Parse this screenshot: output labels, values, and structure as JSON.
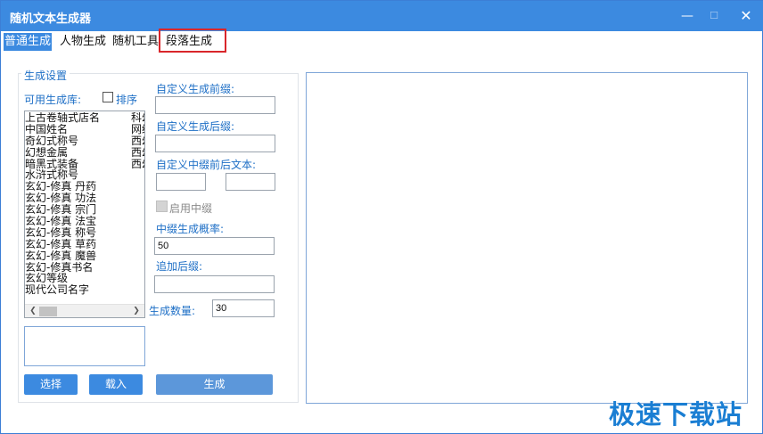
{
  "window": {
    "title": "随机文本生成器",
    "minimize_glyph": "—",
    "maximize_glyph": "☐",
    "close_glyph": "✕"
  },
  "tabs": [
    {
      "label": "普通生成",
      "active": true
    },
    {
      "label": "人物生成",
      "active": false
    },
    {
      "label": "随机工具",
      "active": false
    },
    {
      "label": "段落生成",
      "active": false
    }
  ],
  "settings": {
    "group_title": "生成设置",
    "library_label": "可用生成库:",
    "sort_label": "排序",
    "sort_checked": false,
    "library_items": [
      "上古卷轴式店名",
      "中国姓名",
      "奇幻式称号",
      "幻想金属",
      "暗黑式装备",
      "水浒式称号",
      "玄幻-修真 丹药",
      "玄幻-修真 功法",
      "玄幻-修真 宗门",
      "玄幻-修真 法宝",
      "玄幻-修真 称号",
      "玄幻-修真 草药",
      "玄幻-修真 魔兽",
      "玄幻-修真书名",
      "玄幻等级",
      "现代公司名字"
    ],
    "library_items_col2": [
      "科幻",
      "网络",
      "西幻",
      "西幻",
      "西幻"
    ],
    "prefix_label": "自定义生成前缀:",
    "prefix_value": "",
    "suffix_label": "自定义生成后缀:",
    "suffix_value": "",
    "middle_label": "自定义中缀前后文本:",
    "middle_before_value": "",
    "middle_after_value": "",
    "enable_middle_label": "启用中缀",
    "middle_prob_label": "中缀生成概率:",
    "middle_prob_value": "50",
    "append_suffix_label": "追加后缀:",
    "append_suffix_value": "",
    "count_label": "生成数量:",
    "count_value": "30"
  },
  "buttons": {
    "select": "选择",
    "load": "载入",
    "generate": "生成"
  },
  "output": {
    "text": ""
  },
  "watermark": "极速下载站",
  "colors": {
    "accent": "#3c8ae0",
    "label_blue": "#1e6fc6",
    "highlight_red": "#d9262b"
  }
}
